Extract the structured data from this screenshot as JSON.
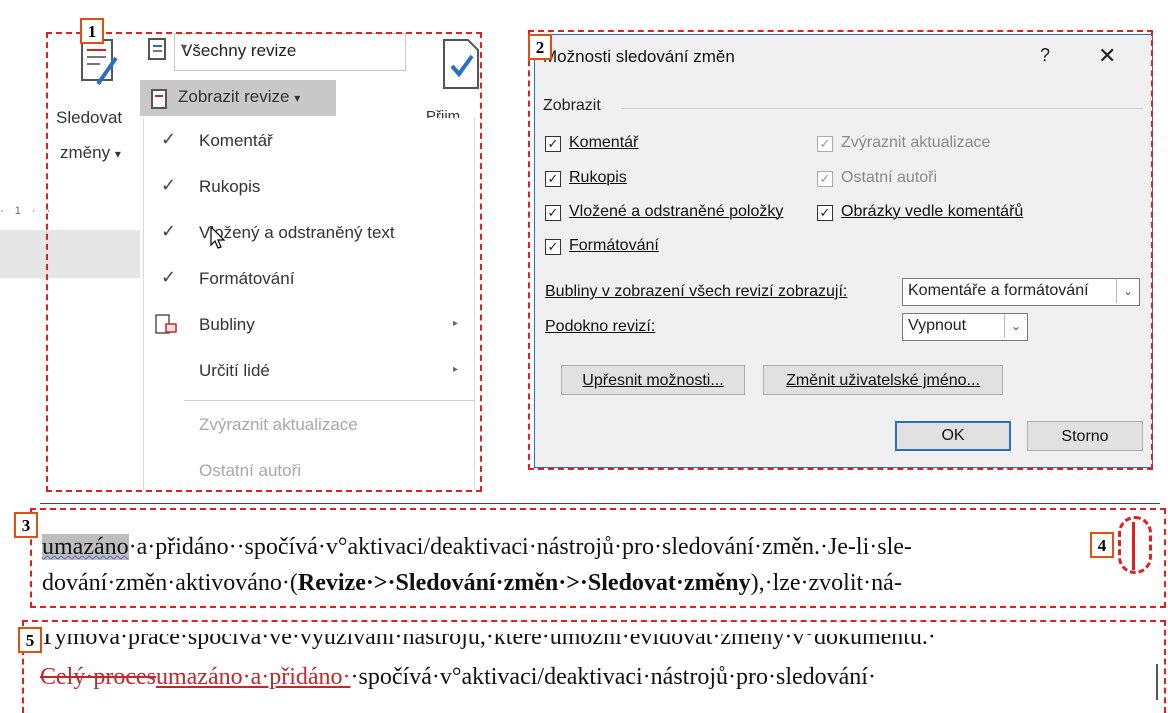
{
  "labels": {
    "n1": "1",
    "n2": "2",
    "n3": "3",
    "n4": "4",
    "n5": "5"
  },
  "ribbon": {
    "track_label_line1": "Sledovat",
    "track_label_line2": "změny",
    "track_arrow": "▾",
    "markup_combo": "Všechny revize",
    "show_markup_button": "Zobrazit revize",
    "show_markup_arrow": "▾",
    "accept_partial": "Přijm",
    "ruler_text": "· 1 · ·",
    "menu": [
      {
        "check": "✓",
        "label": "Komentář",
        "enabled": true
      },
      {
        "check": "✓",
        "label": "Rukopis",
        "enabled": true
      },
      {
        "check": "✓",
        "label": "Vložený a odstraněný text",
        "enabled": true
      },
      {
        "check": "✓",
        "label": "Formátování",
        "enabled": true
      },
      {
        "check": "",
        "label": "Bubliny",
        "enabled": true,
        "submenu": "▸",
        "icon": "balloons-icon"
      },
      {
        "check": "",
        "label": "Určití lidé",
        "enabled": true,
        "submenu": "▸"
      },
      {
        "check": "",
        "label": "Zvýraznit aktualizace",
        "enabled": false
      },
      {
        "check": "",
        "label": "Ostatní autoři",
        "enabled": false
      }
    ]
  },
  "dialog": {
    "title": "Možnosti sledování změn",
    "help": "?",
    "close": "✕",
    "group_label": "Zobrazit",
    "checkboxes_left": [
      {
        "label": "Komentář",
        "checked": true
      },
      {
        "label": "Rukopis",
        "checked": true
      },
      {
        "label": "Vložené a odstraněné položky",
        "checked": true
      },
      {
        "label": "Formátování",
        "checked": true
      }
    ],
    "checkboxes_right": [
      {
        "label": "Zvýraznit aktualizace",
        "checked": true,
        "enabled": false
      },
      {
        "label": "Ostatní autoři",
        "checked": true,
        "enabled": false
      },
      {
        "label": "Obrázky vedle komentářů",
        "checked": true,
        "enabled": true
      }
    ],
    "check_glyph": "✓",
    "balloons_label": "Bubliny v zobrazení všech revizí zobrazují:",
    "balloons_value": "Komentáře a formátování",
    "pane_label": "Podokno revizí:",
    "pane_value": "Vypnout",
    "dropdown_glyph": "⌄",
    "advanced_button": "Upřesnit možnosti...",
    "change_user_button": "Změnit uživatelské jméno...",
    "ok_button": "OK",
    "cancel_button": "Storno"
  },
  "doc3": {
    "line1_highlight": "umazáno",
    "line1_rest": "·a·přidáno··spočívá·v°aktivaci/deaktivaci·nástrojů·pro·sledování·změn.·Je-li·sle-",
    "line2_start": "dování·změn·aktivováno·(",
    "line2_bold": "Revize·>·Sledování·změn·>·Sledovat·změny",
    "line2_end": "),·lze·zvolit·ná-"
  },
  "doc5": {
    "line1": "Týmová·práce·spočívá·ve·využívání·nástrojů,·které·umožní·evidovat·změny·v°dokumentu.·",
    "line2_deleted": "Celý·proces",
    "line2_inserted": "umazáno·a·přidáno·",
    "line2_rest": "·spočívá·v°aktivaci/deaktivaci·nástrojů·pro·sledování·"
  },
  "colors": {
    "annotation": "#e02020",
    "dialog_border": "#2b6cc4",
    "revision": "#c0282c"
  }
}
